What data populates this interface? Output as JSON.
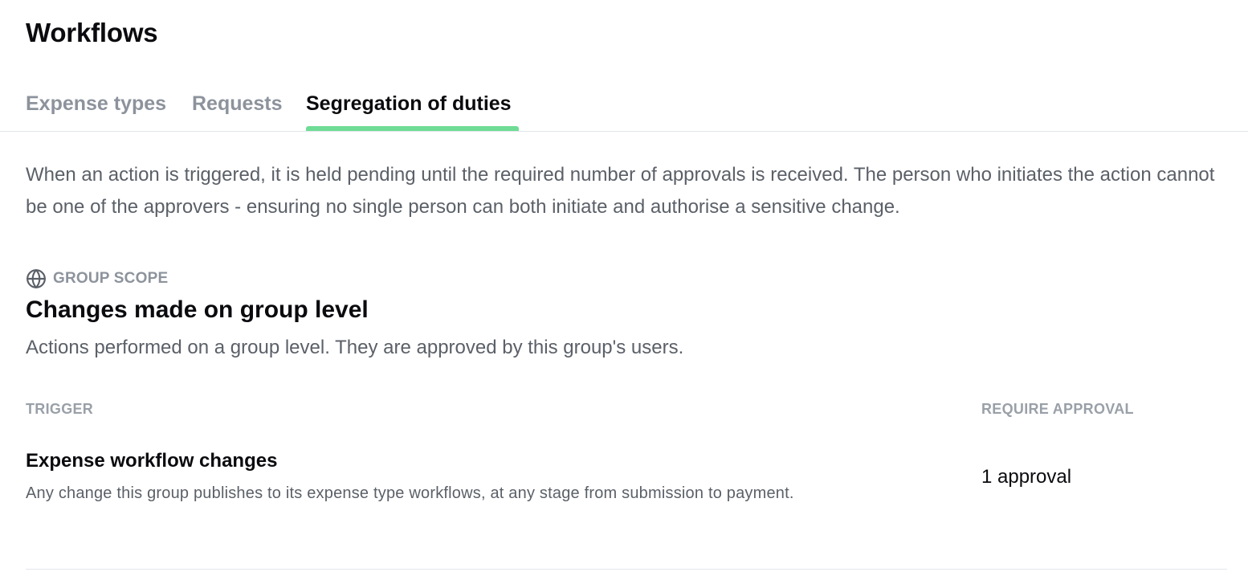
{
  "page": {
    "title": "Workflows"
  },
  "tabs": [
    {
      "label": "Expense types",
      "active": false
    },
    {
      "label": "Requests",
      "active": false
    },
    {
      "label": "Segregation of duties",
      "active": true
    }
  ],
  "intro": {
    "text": "When an action is triggered, it is held pending until the required number of approvals is received. The person who initiates the action cannot be one of the approvers - ensuring no single person can both initiate and authorise a sensitive change."
  },
  "section": {
    "scope_icon": "globe-icon",
    "scope_label": "GROUP SCOPE",
    "title": "Changes made on group level",
    "subtitle": "Actions performed on a group level. They are approved by this group's users."
  },
  "table": {
    "columns": {
      "trigger": "TRIGGER",
      "approval": "REQUIRE APPROVAL"
    },
    "rows": [
      {
        "title": "Expense workflow changes",
        "description": "Any change this group publishes to its expense type workflows, at any stage from submission to payment.",
        "approval": "1 approval"
      }
    ]
  },
  "colors": {
    "active_tab_indicator": "#6fdc95",
    "muted_text": "#8d939c",
    "body_text": "#5b6068",
    "divider": "#e3e6ea"
  }
}
